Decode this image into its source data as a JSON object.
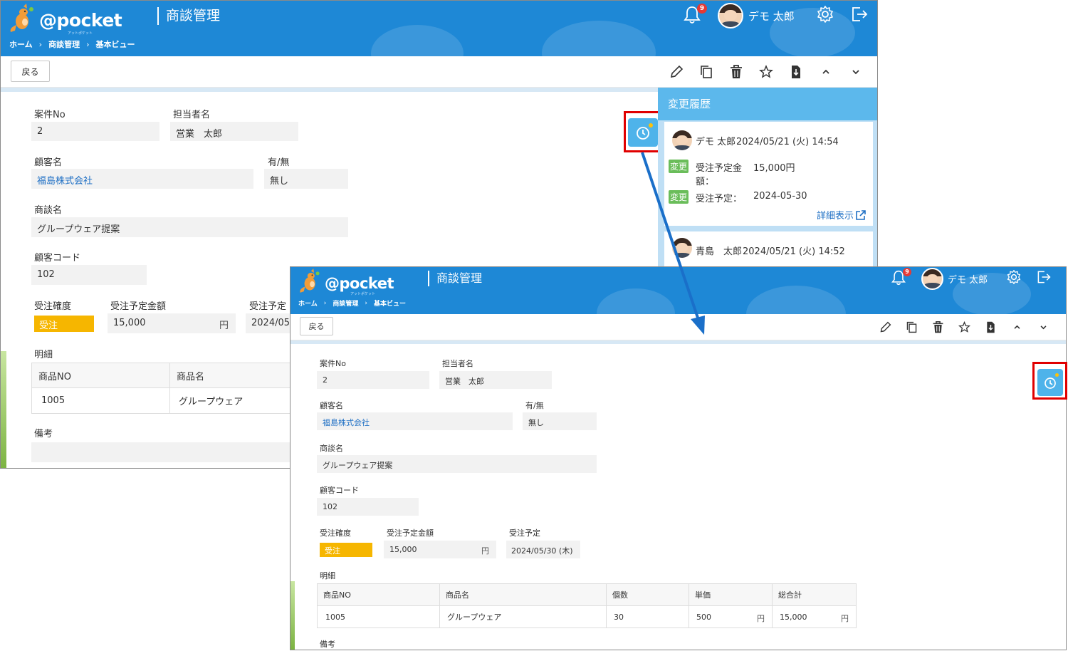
{
  "app": {
    "logo_text": "@pocket",
    "logo_sub": "アットポケット",
    "title": "商談管理",
    "breadcrumb": [
      "ホーム",
      "商談管理",
      "基本ビュー"
    ],
    "notification_count": "9",
    "user_name": "デモ 太郎"
  },
  "toolbar": {
    "back_label": "戻る"
  },
  "form": {
    "case_no_label": "案件No",
    "case_no": "2",
    "owner_label": "担当者名",
    "owner": "営業　太郎",
    "customer_label": "顧客名",
    "customer": "福島株式会社",
    "flag_label": "有/無",
    "flag": "無し",
    "deal_name_label": "商談名",
    "deal_name": "グループウェア提案",
    "customer_code_label": "顧客コード",
    "customer_code": "102",
    "certainty_label": "受注確度",
    "certainty": "受注",
    "amount_label": "受注予定金額",
    "amount": "15,000",
    "yen": "円",
    "order_date_label": "受注予定",
    "order_date": "2024/05/30 (木)",
    "order_date_partial": "2024/05/",
    "details_label": "明細",
    "remarks_label": "備考"
  },
  "details_table": {
    "headers": [
      "商品NO",
      "商品名",
      "個数",
      "単価",
      "総合計"
    ],
    "rows": [
      {
        "product_no": "1005",
        "product_name": "グループウェア",
        "qty": "30",
        "unit_price": "500",
        "total": "15,000"
      }
    ]
  },
  "history": {
    "title": "変更履歴",
    "entries": [
      {
        "user": "デモ 太郎",
        "datetime": "2024/05/21 (火) 14:54",
        "changes": [
          {
            "tag": "変更",
            "field_line1": "受注予定金",
            "field_line2": "額：",
            "value": "15,000円"
          },
          {
            "tag": "変更",
            "field_line1": "受注予定：",
            "field_line2": "",
            "value": "2024-05-30"
          }
        ],
        "detail_link": "詳細表示"
      },
      {
        "user": "青島　太郎",
        "datetime": "2024/05/21 (火) 14:52"
      }
    ]
  },
  "colors": {
    "header": "#1e88d6",
    "history_button": "#4eb3ea",
    "status_badge": "#f6b600",
    "change_tag": "#6abd5a",
    "highlight_box": "#e00000",
    "arrow": "#1a6fc9"
  }
}
